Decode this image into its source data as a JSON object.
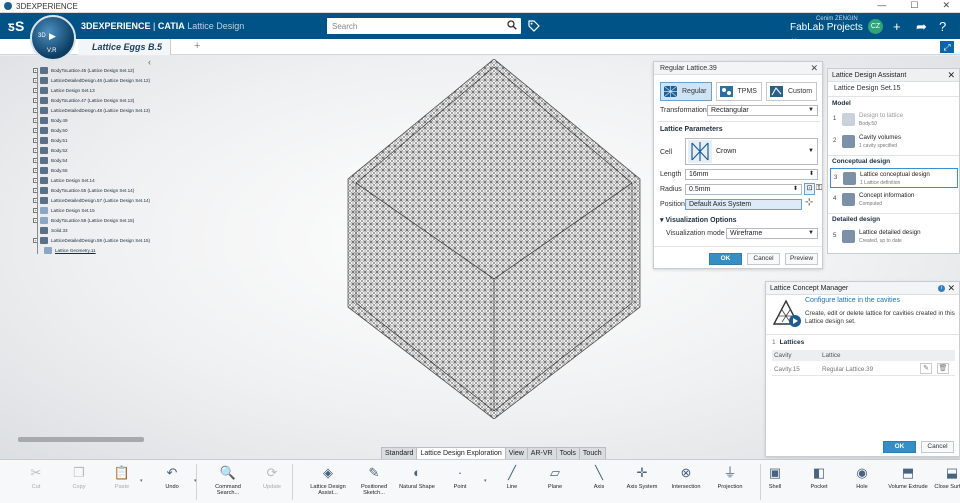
{
  "os_window": {
    "title": "3DEXPERIENCE"
  },
  "header": {
    "brand": "3DEXPERIENCE",
    "separator": " | ",
    "app_name": "CATIA",
    "app_role": "Lattice Design",
    "compass_top": "3D",
    "compass_bottom": "V.R",
    "search_placeholder": "Search",
    "user_name": "Cenim ZENGIN",
    "project": "FabLab Projects",
    "avatar_initials": "CZ"
  },
  "tabs": {
    "document": "Lattice Eggs B.5",
    "add": "+"
  },
  "tree": {
    "collapse": "‹",
    "items": [
      {
        "label": "BodyToLattice.45 (Lattice Design Set.12)",
        "icon": "body"
      },
      {
        "label": "LatticeDetailedDesign.46 (Lattice Design Set.12)",
        "icon": "body"
      },
      {
        "label": "Lattice Design Set.13",
        "icon": "body"
      },
      {
        "label": "BodyToLattice.47 (Lattice Design Set.13)",
        "icon": "body"
      },
      {
        "label": "LatticeDetailedDesign.48 (Lattice Design Set.13)",
        "icon": "body"
      },
      {
        "label": "Body.49",
        "icon": "body"
      },
      {
        "label": "Body.50",
        "icon": "body"
      },
      {
        "label": "Body.51",
        "icon": "body"
      },
      {
        "label": "Body.52",
        "icon": "body"
      },
      {
        "label": "Body.54",
        "icon": "body"
      },
      {
        "label": "Body.55",
        "icon": "body"
      },
      {
        "label": "Lattice Design Set.14",
        "icon": "body"
      },
      {
        "label": "BodyToLattice.55 (Lattice Design Set.14)",
        "icon": "body"
      },
      {
        "label": "LatticeDetailedDesign.57 (Lattice Design Set.14)",
        "icon": "body"
      },
      {
        "label": "Lattice Design Set.15",
        "icon": "light"
      },
      {
        "label": "BodyToLattice.58 (Lattice Design Set.15)",
        "icon": "light"
      },
      {
        "label": "Solid.33",
        "icon": "body"
      },
      {
        "label": "LatticeDetailedDesign.59 (Lattice Design Set.15)",
        "icon": "body"
      },
      {
        "label": "Lattice Geometry.11",
        "icon": "light"
      }
    ]
  },
  "regular_lattice": {
    "title": "Regular Lattice.39",
    "types": [
      "Regular",
      "TPMS",
      "Custom"
    ],
    "transformation_label": "Transformation",
    "transformation_value": "Rectangular",
    "params_header": "Lattice Parameters",
    "cell_label": "Cell",
    "cell_value": "Crown",
    "length_label": "Length",
    "length_value": "16mm",
    "radius_label": "Radius",
    "radius_value": "0.5mm",
    "position_label": "Position",
    "position_value": "Default Axis System",
    "vis_header": "Visualization Options",
    "vis_mode_label": "Visualization mode",
    "vis_mode_value": "Wireframe",
    "ok": "OK",
    "cancel": "Cancel",
    "preview": "Preview"
  },
  "assistant": {
    "title": "Lattice Design Assistant",
    "set_name": "Lattice Design Set.15",
    "model_header": "Model",
    "conceptual_header": "Conceptual design",
    "detailed_header": "Detailed design",
    "steps": [
      {
        "num": "1",
        "title": "Design to lattice",
        "sub": "Body.50"
      },
      {
        "num": "2",
        "title": "Cavity volumes",
        "sub": "1 cavity specified"
      },
      {
        "num": "3",
        "title": "Lattice conceptual design",
        "sub": "1 Lattice definition"
      },
      {
        "num": "4",
        "title": "Concept information",
        "sub": "Computed"
      },
      {
        "num": "5",
        "title": "Lattice detailed design",
        "sub": "Created, up to date"
      }
    ]
  },
  "concept_manager": {
    "title": "Lattice Concept Manager",
    "link": "Configure lattice in the cavities",
    "description": "Create, edit or delete lattice for cavities created in this Lattice design set.",
    "lattices_count": "1",
    "lattices_label": "Lattices",
    "col_cavity": "Cavity",
    "col_lattice": "Lattice",
    "row_cavity": "Cavity.15",
    "row_lattice": "Regular Lattice.39",
    "ok": "OK",
    "cancel": "Cancel"
  },
  "workbench_tabs": [
    "Standard",
    "Lattice Design Exploration",
    "View",
    "AR-VR",
    "Tools",
    "Touch"
  ],
  "action_bar": [
    {
      "label": "Cut",
      "icon": "scissors-icon",
      "glyph": "✂"
    },
    {
      "label": "Copy",
      "icon": "copy-icon",
      "glyph": "❐"
    },
    {
      "label": "Paste",
      "icon": "paste-icon",
      "glyph": "📋"
    },
    {
      "label": "Undo",
      "icon": "undo-icon",
      "glyph": "↶"
    },
    {
      "label": "Command Search...",
      "icon": "command-search-icon",
      "glyph": "🔍"
    },
    {
      "label": "Update",
      "icon": "update-icon",
      "glyph": "⟳"
    },
    {
      "label": "Lattice Design Assist...",
      "icon": "lattice-assistant-icon",
      "glyph": "◈"
    },
    {
      "label": "Positioned Sketch...",
      "icon": "positioned-sketch-icon",
      "glyph": "✎"
    },
    {
      "label": "Natural Shape",
      "icon": "natural-shape-icon",
      "glyph": "◐"
    },
    {
      "label": "Point",
      "icon": "point-icon",
      "glyph": "·"
    },
    {
      "label": "Line",
      "icon": "line-icon",
      "glyph": "╱"
    },
    {
      "label": "Plane",
      "icon": "plane-icon",
      "glyph": "▱"
    },
    {
      "label": "Axis",
      "icon": "axis-icon",
      "glyph": "╲"
    },
    {
      "label": "Axis System",
      "icon": "axis-system-icon",
      "glyph": "✛"
    },
    {
      "label": "Intersection",
      "icon": "intersection-icon",
      "glyph": "⊗"
    },
    {
      "label": "Projection",
      "icon": "projection-icon",
      "glyph": "⏚"
    },
    {
      "label": "Shell",
      "icon": "shell-icon",
      "glyph": "▣"
    },
    {
      "label": "Pocket",
      "icon": "pocket-icon",
      "glyph": "◧"
    },
    {
      "label": "Hole",
      "icon": "hole-icon",
      "glyph": "◉"
    },
    {
      "label": "Volume Extrude",
      "icon": "volume-extrude-icon",
      "glyph": "⬒"
    },
    {
      "label": "Close Surface",
      "icon": "close-surface-icon",
      "glyph": "⬓"
    }
  ],
  "colors": {
    "header": "#005386",
    "accent": "#368ec4",
    "link": "#1a73b8"
  }
}
